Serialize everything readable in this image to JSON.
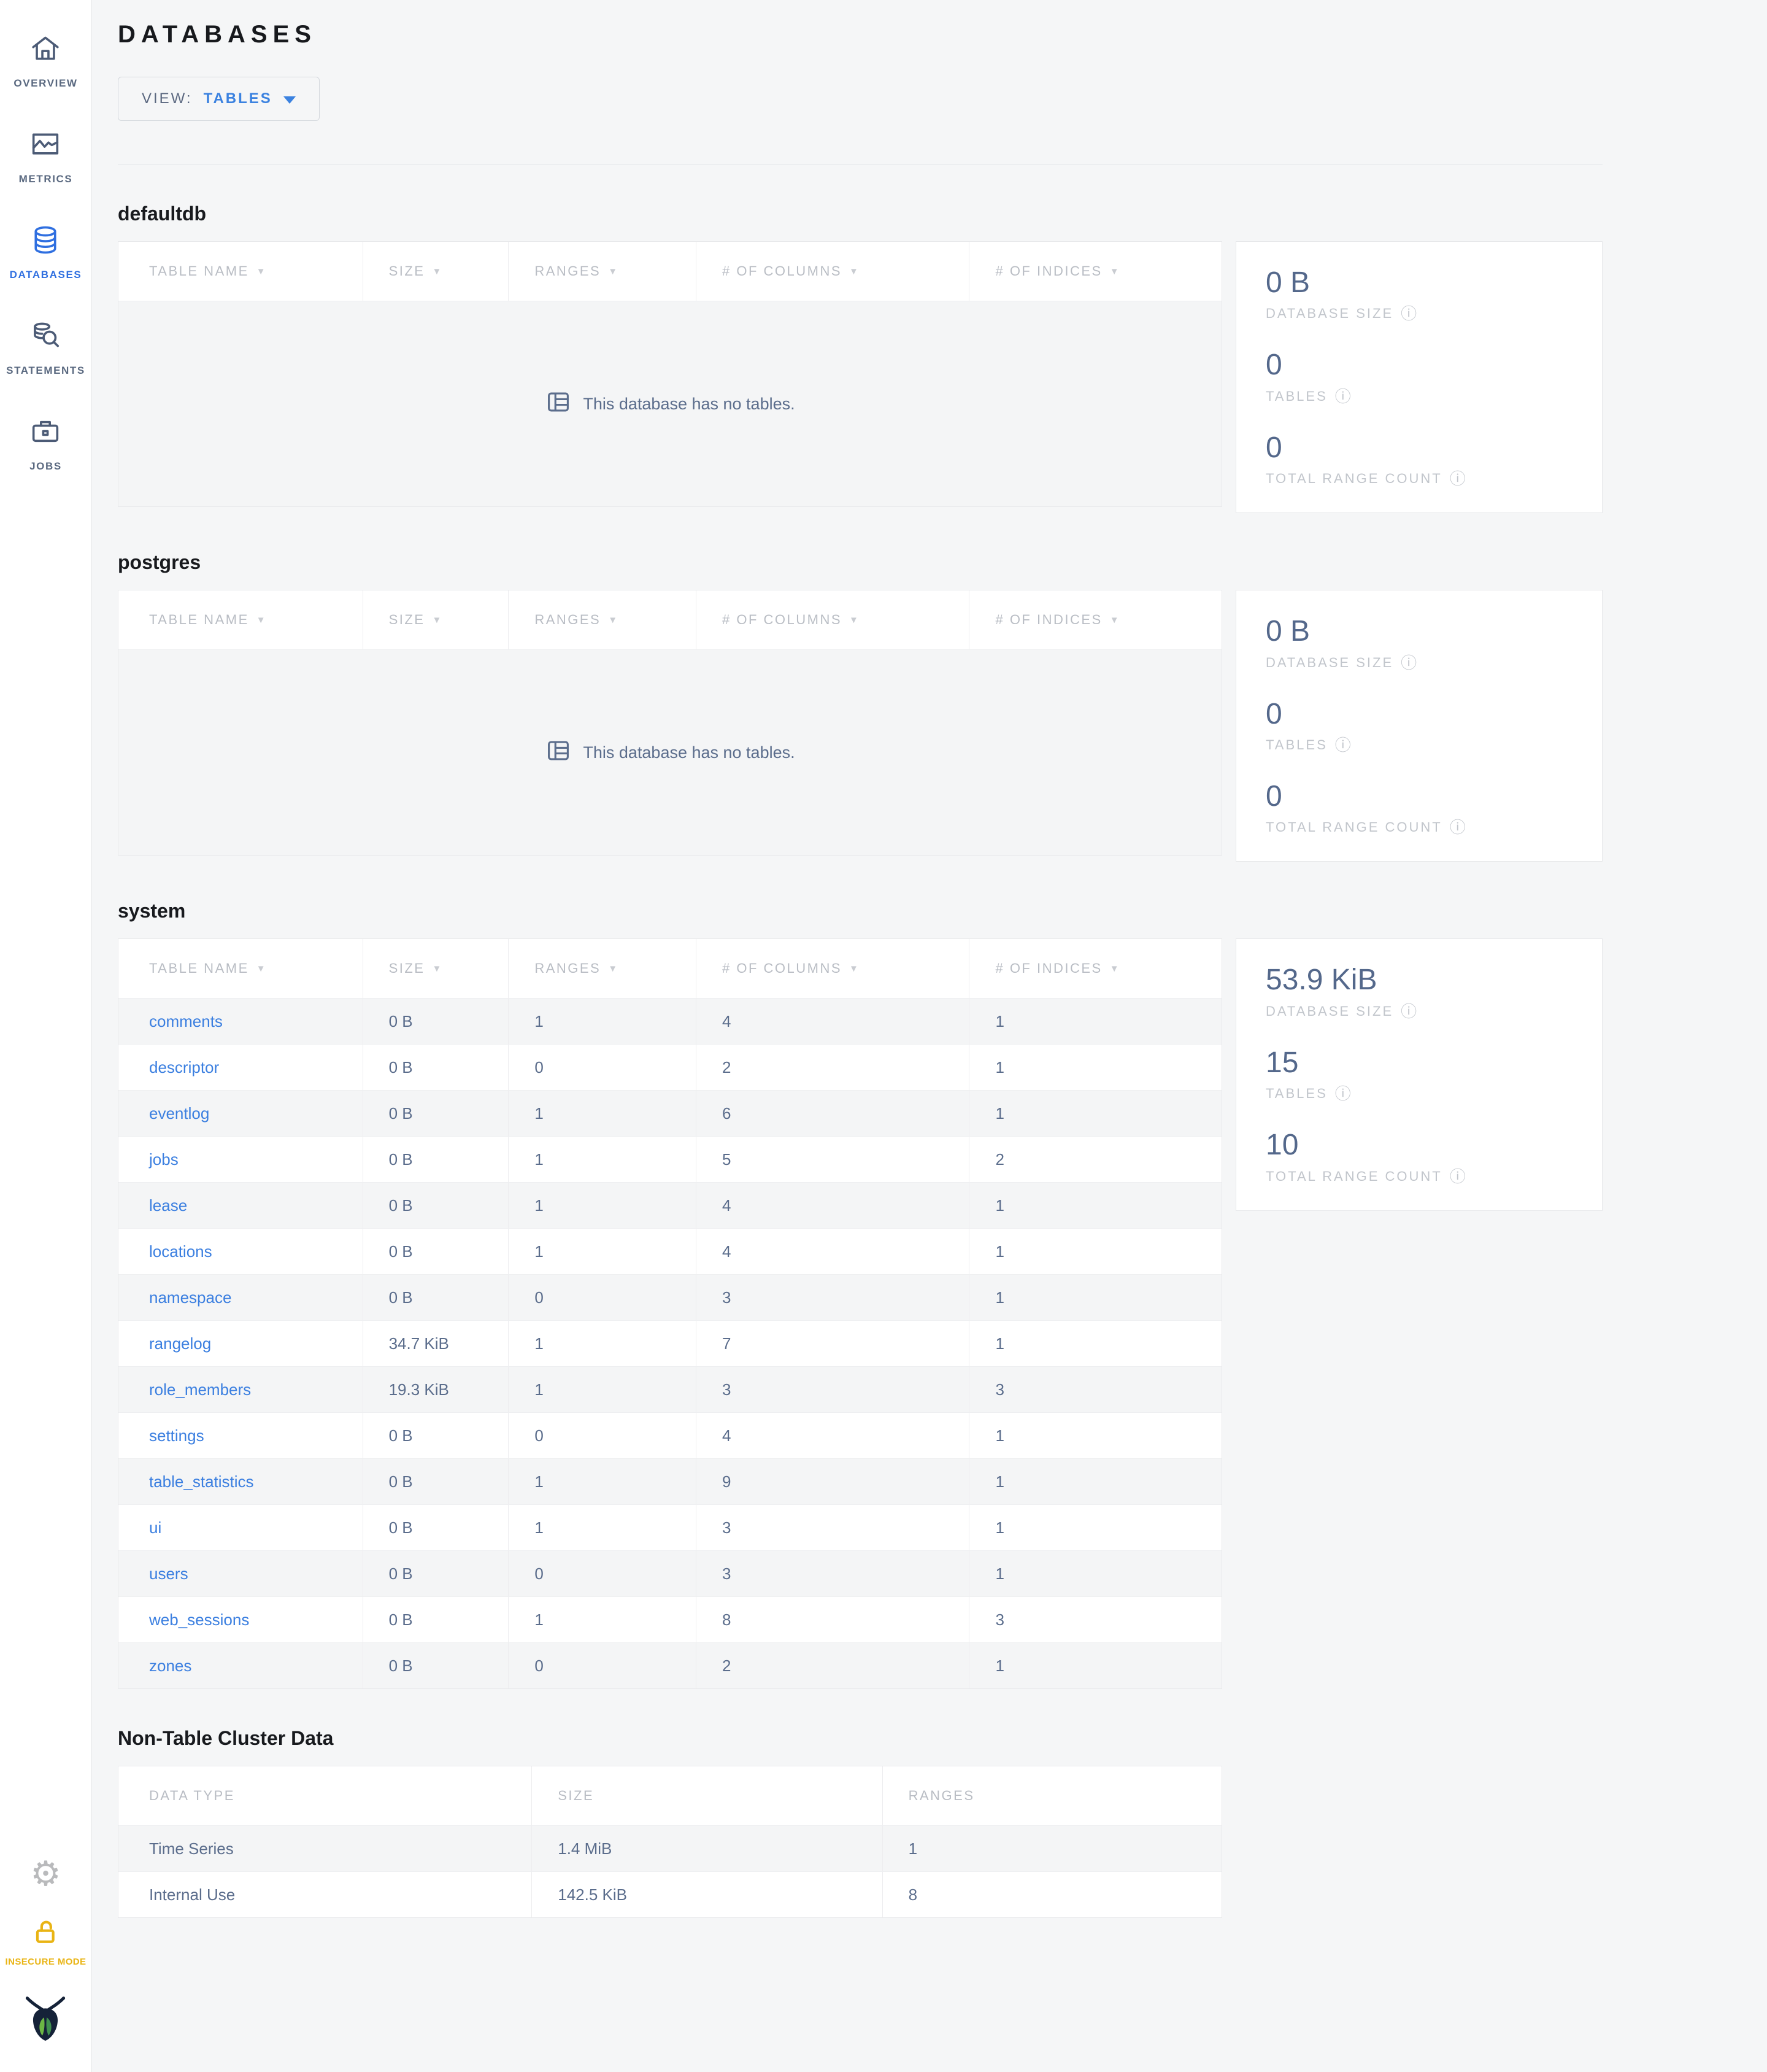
{
  "header": {
    "title": "DATABASES",
    "view_label": "VIEW:",
    "view_value": "TABLES"
  },
  "sidebar": {
    "items": [
      {
        "label": "OVERVIEW",
        "icon": "home-icon",
        "active": false
      },
      {
        "label": "METRICS",
        "icon": "metrics-icon",
        "active": false
      },
      {
        "label": "DATABASES",
        "icon": "databases-icon",
        "active": true
      },
      {
        "label": "STATEMENTS",
        "icon": "statements-icon",
        "active": false
      },
      {
        "label": "JOBS",
        "icon": "jobs-icon",
        "active": false
      }
    ],
    "insecure_label": "INSECURE MODE"
  },
  "table_headers": [
    "TABLE NAME",
    "SIZE",
    "RANGES",
    "# OF COLUMNS",
    "# OF INDICES"
  ],
  "empty_message": "This database has no tables.",
  "stats_labels": {
    "size": "DATABASE SIZE",
    "tables": "TABLES",
    "range_count": "TOTAL RANGE COUNT"
  },
  "databases": [
    {
      "name": "defaultdb",
      "empty": true,
      "stats": {
        "size": "0 B",
        "tables": "0",
        "range_count": "0"
      },
      "rows": []
    },
    {
      "name": "postgres",
      "empty": true,
      "stats": {
        "size": "0 B",
        "tables": "0",
        "range_count": "0"
      },
      "rows": []
    },
    {
      "name": "system",
      "empty": false,
      "stats": {
        "size": "53.9 KiB",
        "tables": "15",
        "range_count": "10"
      },
      "rows": [
        [
          "comments",
          "0 B",
          "1",
          "4",
          "1"
        ],
        [
          "descriptor",
          "0 B",
          "0",
          "2",
          "1"
        ],
        [
          "eventlog",
          "0 B",
          "1",
          "6",
          "1"
        ],
        [
          "jobs",
          "0 B",
          "1",
          "5",
          "2"
        ],
        [
          "lease",
          "0 B",
          "1",
          "4",
          "1"
        ],
        [
          "locations",
          "0 B",
          "1",
          "4",
          "1"
        ],
        [
          "namespace",
          "0 B",
          "0",
          "3",
          "1"
        ],
        [
          "rangelog",
          "34.7 KiB",
          "1",
          "7",
          "1"
        ],
        [
          "role_members",
          "19.3 KiB",
          "1",
          "3",
          "3"
        ],
        [
          "settings",
          "0 B",
          "0",
          "4",
          "1"
        ],
        [
          "table_statistics",
          "0 B",
          "1",
          "9",
          "1"
        ],
        [
          "ui",
          "0 B",
          "1",
          "3",
          "1"
        ],
        [
          "users",
          "0 B",
          "0",
          "3",
          "1"
        ],
        [
          "web_sessions",
          "0 B",
          "1",
          "8",
          "3"
        ],
        [
          "zones",
          "0 B",
          "0",
          "2",
          "1"
        ]
      ]
    }
  ],
  "non_table": {
    "title": "Non-Table Cluster Data",
    "headers": [
      "DATA TYPE",
      "SIZE",
      "RANGES"
    ],
    "rows": [
      [
        "Time Series",
        "1.4 MiB",
        "1"
      ],
      [
        "Internal Use",
        "142.5 KiB",
        "8"
      ]
    ]
  },
  "colors": {
    "accent_blue": "#2f6fe0",
    "link_blue": "#3b7fe0",
    "stat_slate": "#54688b",
    "insecure_yellow": "#e9b414",
    "page_bg": "#f5f6f7",
    "logo_navy": "#152238",
    "logo_green_light": "#6cb644",
    "logo_green_dark": "#3f8f4f"
  }
}
